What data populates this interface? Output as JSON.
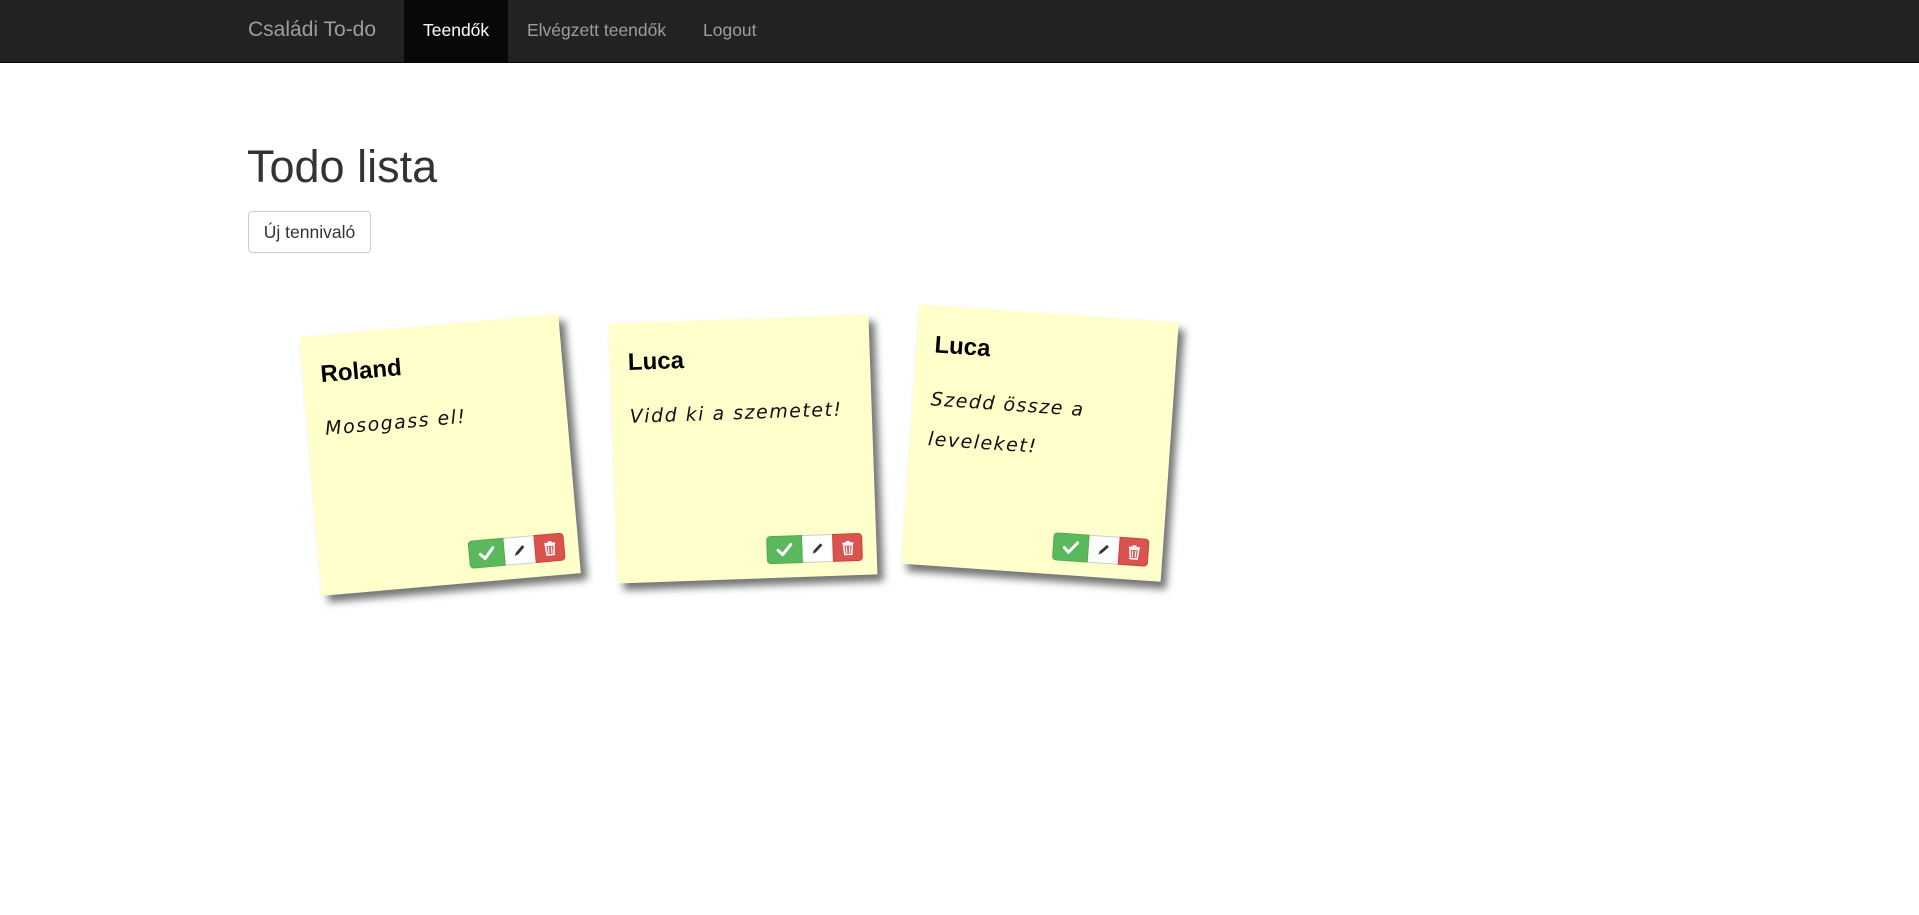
{
  "navbar": {
    "brand": "Családi To-do",
    "items": [
      {
        "label": "Teendők",
        "active": true
      },
      {
        "label": "Elvégzett teendők",
        "active": false
      },
      {
        "label": "Logout",
        "active": false
      }
    ]
  },
  "main": {
    "title": "Todo lista",
    "new_button_label": "Új tennivaló"
  },
  "notes": [
    {
      "owner": "Roland",
      "text": "Mosogass el!"
    },
    {
      "owner": "Luca",
      "text": "Vidd ki a szemetet!"
    },
    {
      "owner": "Luca",
      "text": "Szedd össze a leveleket!"
    }
  ],
  "icons": {
    "done": "check-icon",
    "edit": "pencil-icon",
    "delete": "trash-icon"
  },
  "colors": {
    "navbar_bg": "#222222",
    "note_bg": "#ffffcc",
    "success": "#5cb85c",
    "danger": "#d9534f"
  }
}
